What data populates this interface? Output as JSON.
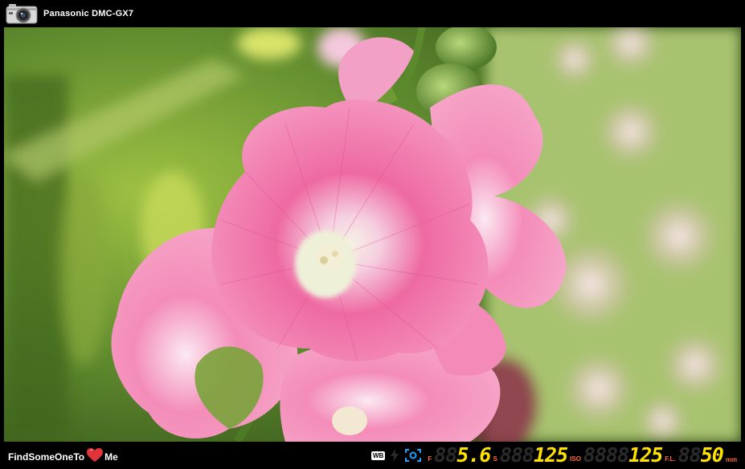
{
  "header": {
    "camera_icon": "camera-icon",
    "model": "Panasonic DMC-GX7"
  },
  "photo": {
    "subject_icon": "pink-hollyhock-photo"
  },
  "footer": {
    "brand_left": "FindSomeOneTo",
    "brand_heart": "heart-icon",
    "brand_right": "Me",
    "wb_label": "WB",
    "flash_icon": "flash-icon",
    "metering_icon": "metering-icon",
    "aperture_label": "F",
    "aperture_ghost": "88",
    "aperture": "5.6",
    "shutter_label": "S",
    "shutter_ghost": "888",
    "shutter": "125",
    "iso_label": "ISO",
    "iso_ghost": "8888",
    "iso": "125",
    "fl_label": "F.L.",
    "fl_ghost": "88",
    "fl": "50",
    "fl_unit": "mm"
  },
  "colors": {
    "lcd_value": "#ffe100",
    "lcd_ghost": "#2b2b2b",
    "label_orange": "#ff6b3a",
    "bar_bg": "#000000"
  }
}
